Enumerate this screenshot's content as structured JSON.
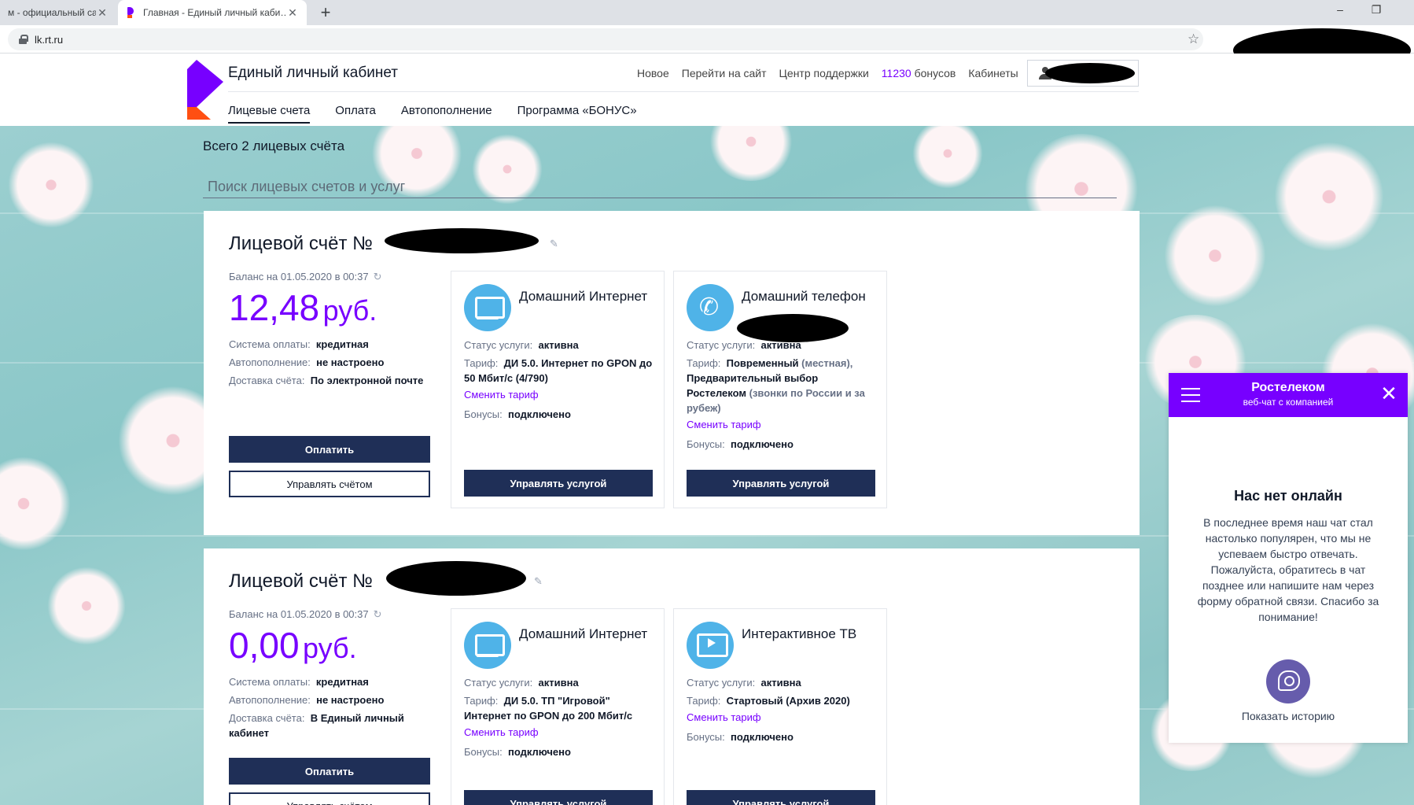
{
  "browser": {
    "tabs": [
      {
        "title": "м - официальный са…"
      },
      {
        "title": "Главная - Единый личный каби…"
      }
    ],
    "new_tab": "+",
    "close": "✕",
    "url": "lk.rt.ru",
    "window_min": "–",
    "window_max": "❐"
  },
  "header": {
    "brand": "Единый личный кабинет",
    "nav": {
      "new": "Новое",
      "site": "Перейти на сайт",
      "support": "Центр поддержки",
      "bonus_count": "11230",
      "bonus_word": "бонусов",
      "cabinets": "Кабинеты"
    },
    "tabs": [
      "Лицевые счета",
      "Оплата",
      "Автопополнение",
      "Программа «БОНУС»"
    ]
  },
  "main": {
    "total": "Всего 2 лицевых счёта",
    "search_placeholder": "Поиск лицевых счетов и услуг"
  },
  "accounts": [
    {
      "title": "Лицевой счёт №",
      "balance_date": "Баланс на 01.05.2020 в 00:37",
      "amount": "12,48",
      "currency": "руб.",
      "payment_system_label": "Система оплаты:",
      "payment_system": "кредитная",
      "autopay_label": "Автопополнение:",
      "autopay": "не настроено",
      "delivery_label": "Доставка счёта:",
      "delivery": "По электронной почте",
      "pay_btn": "Оплатить",
      "manage_btn": "Управлять счётом",
      "services": [
        {
          "name": "Домашний Интернет",
          "status_label": "Статус услуги:",
          "status": "активна",
          "tariff_label": "Тариф:",
          "tariff": "ДИ 5.0. Интернет по GPON до 50 Мбит/с (4/790)",
          "change": "Сменить тариф",
          "bonus_label": "Бонусы:",
          "bonus": "подключено",
          "btn": "Управлять услугой"
        },
        {
          "name": "Домашний телефон",
          "status_label": "Статус услуги:",
          "status": "активна",
          "tariff_label": "Тариф:",
          "tariff_a": "Повременный",
          "tariff_b": "(местная),",
          "tariff_c": "Предварительный выбор Ростелеком",
          "tariff_d": "(звонки по России и за рубеж)",
          "change": "Сменить тариф",
          "bonus_label": "Бонусы:",
          "bonus": "подключено",
          "btn": "Управлять услугой"
        }
      ]
    },
    {
      "title": "Лицевой счёт №",
      "balance_date": "Баланс на 01.05.2020 в 00:37",
      "amount": "0,00",
      "currency": "руб.",
      "payment_system_label": "Система оплаты:",
      "payment_system": "кредитная",
      "autopay_label": "Автопополнение:",
      "autopay": "не настроено",
      "delivery_label": "Доставка счёта:",
      "delivery": "В Единый личный кабинет",
      "pay_btn": "Оплатить",
      "manage_btn": "Управлять счётом",
      "services": [
        {
          "name": "Домашний Интернет",
          "status_label": "Статус услуги:",
          "status": "активна",
          "tariff_label": "Тариф:",
          "tariff": "ДИ 5.0. ТП \"Игровой\" Интернет по GPON до 200 Мбит/с",
          "change": "Сменить тариф",
          "bonus_label": "Бонусы:",
          "bonus": "подключено",
          "btn": "Управлять услугой"
        },
        {
          "name": "Интерактивное ТВ",
          "status_label": "Статус услуги:",
          "status": "активна",
          "tariff_label": "Тариф:",
          "tariff": "Стартовый (Архив 2020)",
          "change": "Сменить тариф",
          "bonus_label": "Бонусы:",
          "bonus": "подключено",
          "btn": "Управлять услугой"
        }
      ]
    }
  ],
  "chat": {
    "title": "Ростелеком",
    "subtitle": "веб-чат с компанией",
    "close": "✕",
    "offline_title": "Нас нет онлайн",
    "offline_text": "В последнее время наш чат стал настолько популярен, что мы не успеваем быстро отвечать. Пожалуйста, обратитесь в чат позднее или напишите нам через форму обратной связи. Спасибо за понимание!",
    "history": "Показать историю"
  },
  "icons": {
    "edit": "✎",
    "refresh": "↻",
    "star": "☆",
    "phone": "✆"
  },
  "colors": {
    "accent": "#7700ff",
    "button": "#1f2f57",
    "service_icon": "#4fb3e8",
    "logo_orange": "#ff4f12"
  }
}
